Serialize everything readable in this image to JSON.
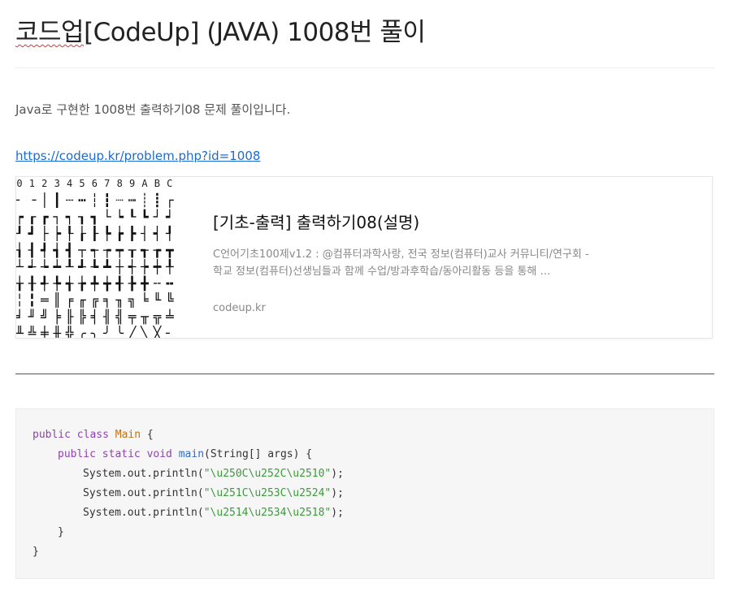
{
  "post": {
    "title_prefix": "코드업",
    "title_rest": "[CodeUp] (JAVA) 1008번 풀이",
    "intro": "Java로 구현한 1008번 출력하기08 문제 풀이입니다.",
    "link": "https://codeup.kr/problem.php?id=1008"
  },
  "card": {
    "title": "[기초-출력] 출력하기08(설명)",
    "description": "C언어기초100제v1.2 : @컴퓨터과학사랑, 전국 정보(컴퓨터)교사 커뮤니티/연구회 - 학교 정보(컴퓨터)선생님들과 함께 수업/방과후학습/동아리활동 등을 통해 …",
    "domain": "codeup.kr",
    "thumbnail": {
      "header": [
        "0",
        "1",
        "2",
        "3",
        "4",
        "5",
        "6",
        "7",
        "8",
        "9",
        "A",
        "B",
        "C"
      ],
      "rows": [
        "╴╶│┃┄┅┆┇┈┉┊┋┌",
        "┍┎┏┐┑┒┓└┕┖┗┘┙",
        "┚┛├┝┞┟┠┡┢┣┤┥┦",
        "┧┨┩┪┫┬┭┮┯┰┱┲┳",
        "┴┵┶┷┸┹┺┻┼┽┾┿╀",
        "╁╂╃╄╅╆╇╈╉╊╋╌╍",
        "╎╏═║╒╓╔╕╖╗╘╙╚",
        "╛╜╝╞╟╠╡╢╣╤╥╦╧",
        "╨╩╪╫╬╭╮╯╰╱╲╳╴"
      ]
    }
  },
  "code": {
    "l1_kw": "public class",
    "l1_cls": "Main",
    "l1_rest": " {",
    "l2_kw": "public static void",
    "l2_fn": "main",
    "l2_rest": "(String[] args) {",
    "l3_pre": "System.out.println(",
    "l3_str": "\"\\u250C\\u252C\\u2510\"",
    "l3_post": ");",
    "l4_pre": "System.out.println(",
    "l4_str": "\"\\u251C\\u253C\\u2524\"",
    "l4_post": ");",
    "l5_pre": "System.out.println(",
    "l5_str": "\"\\u2514\\u2534\\u2518\"",
    "l5_post": ");",
    "l6": "}",
    "l7": "}"
  }
}
